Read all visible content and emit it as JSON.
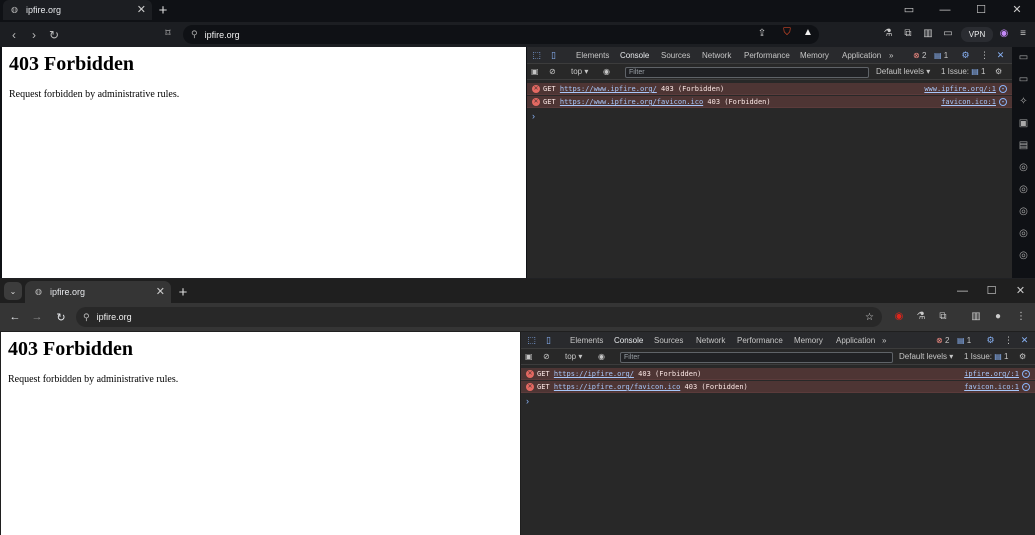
{
  "top_window": {
    "tab_title": "ipfire.org",
    "url": "ipfire.org",
    "vpn_label": "VPN",
    "page": {
      "heading": "403 Forbidden",
      "body": "Request forbidden by administrative rules."
    },
    "devtools": {
      "tabs": [
        "Elements",
        "Console",
        "Sources",
        "Network",
        "Performance",
        "Memory",
        "Application"
      ],
      "more_tabs": "»",
      "error_count": "2",
      "message_count": "1",
      "context": "top",
      "filter_placeholder": "Filter",
      "levels": "Default levels",
      "issues": "1 Issue:",
      "issues_count": "1",
      "rows": [
        {
          "method": "GET",
          "url": "https://www.ipfire.org/",
          "status": "403 (Forbidden)",
          "source": "www.ipfire.org/:1"
        },
        {
          "method": "GET",
          "url": "https://www.ipfire.org/favicon.ico",
          "status": "403 (Forbidden)",
          "source": "favicon.ico:1"
        }
      ],
      "prompt": "›"
    }
  },
  "bottom_window": {
    "tab_title": "ipfire.org",
    "url": "ipfire.org",
    "page": {
      "heading": "403 Forbidden",
      "body": "Request forbidden by administrative rules."
    },
    "devtools": {
      "tabs": [
        "Elements",
        "Console",
        "Sources",
        "Network",
        "Performance",
        "Memory",
        "Application"
      ],
      "more_tabs": "»",
      "error_count": "2",
      "message_count": "1",
      "context": "top",
      "filter_placeholder": "Filter",
      "levels": "Default levels",
      "issues": "1 Issue:",
      "issues_count": "1",
      "rows": [
        {
          "method": "GET",
          "url": "https://ipfire.org/",
          "status": "403 (Forbidden)",
          "source": "ipfire.org/:1"
        },
        {
          "method": "GET",
          "url": "https://ipfire.org/favicon.ico",
          "status": "403 (Forbidden)",
          "source": "favicon.ico:1"
        }
      ],
      "prompt": "›"
    }
  },
  "colors": {
    "accent": "#8ab4f8",
    "error_row": "#4e3534",
    "error_icon": "#e46962",
    "page_bg": "#ffffff"
  }
}
